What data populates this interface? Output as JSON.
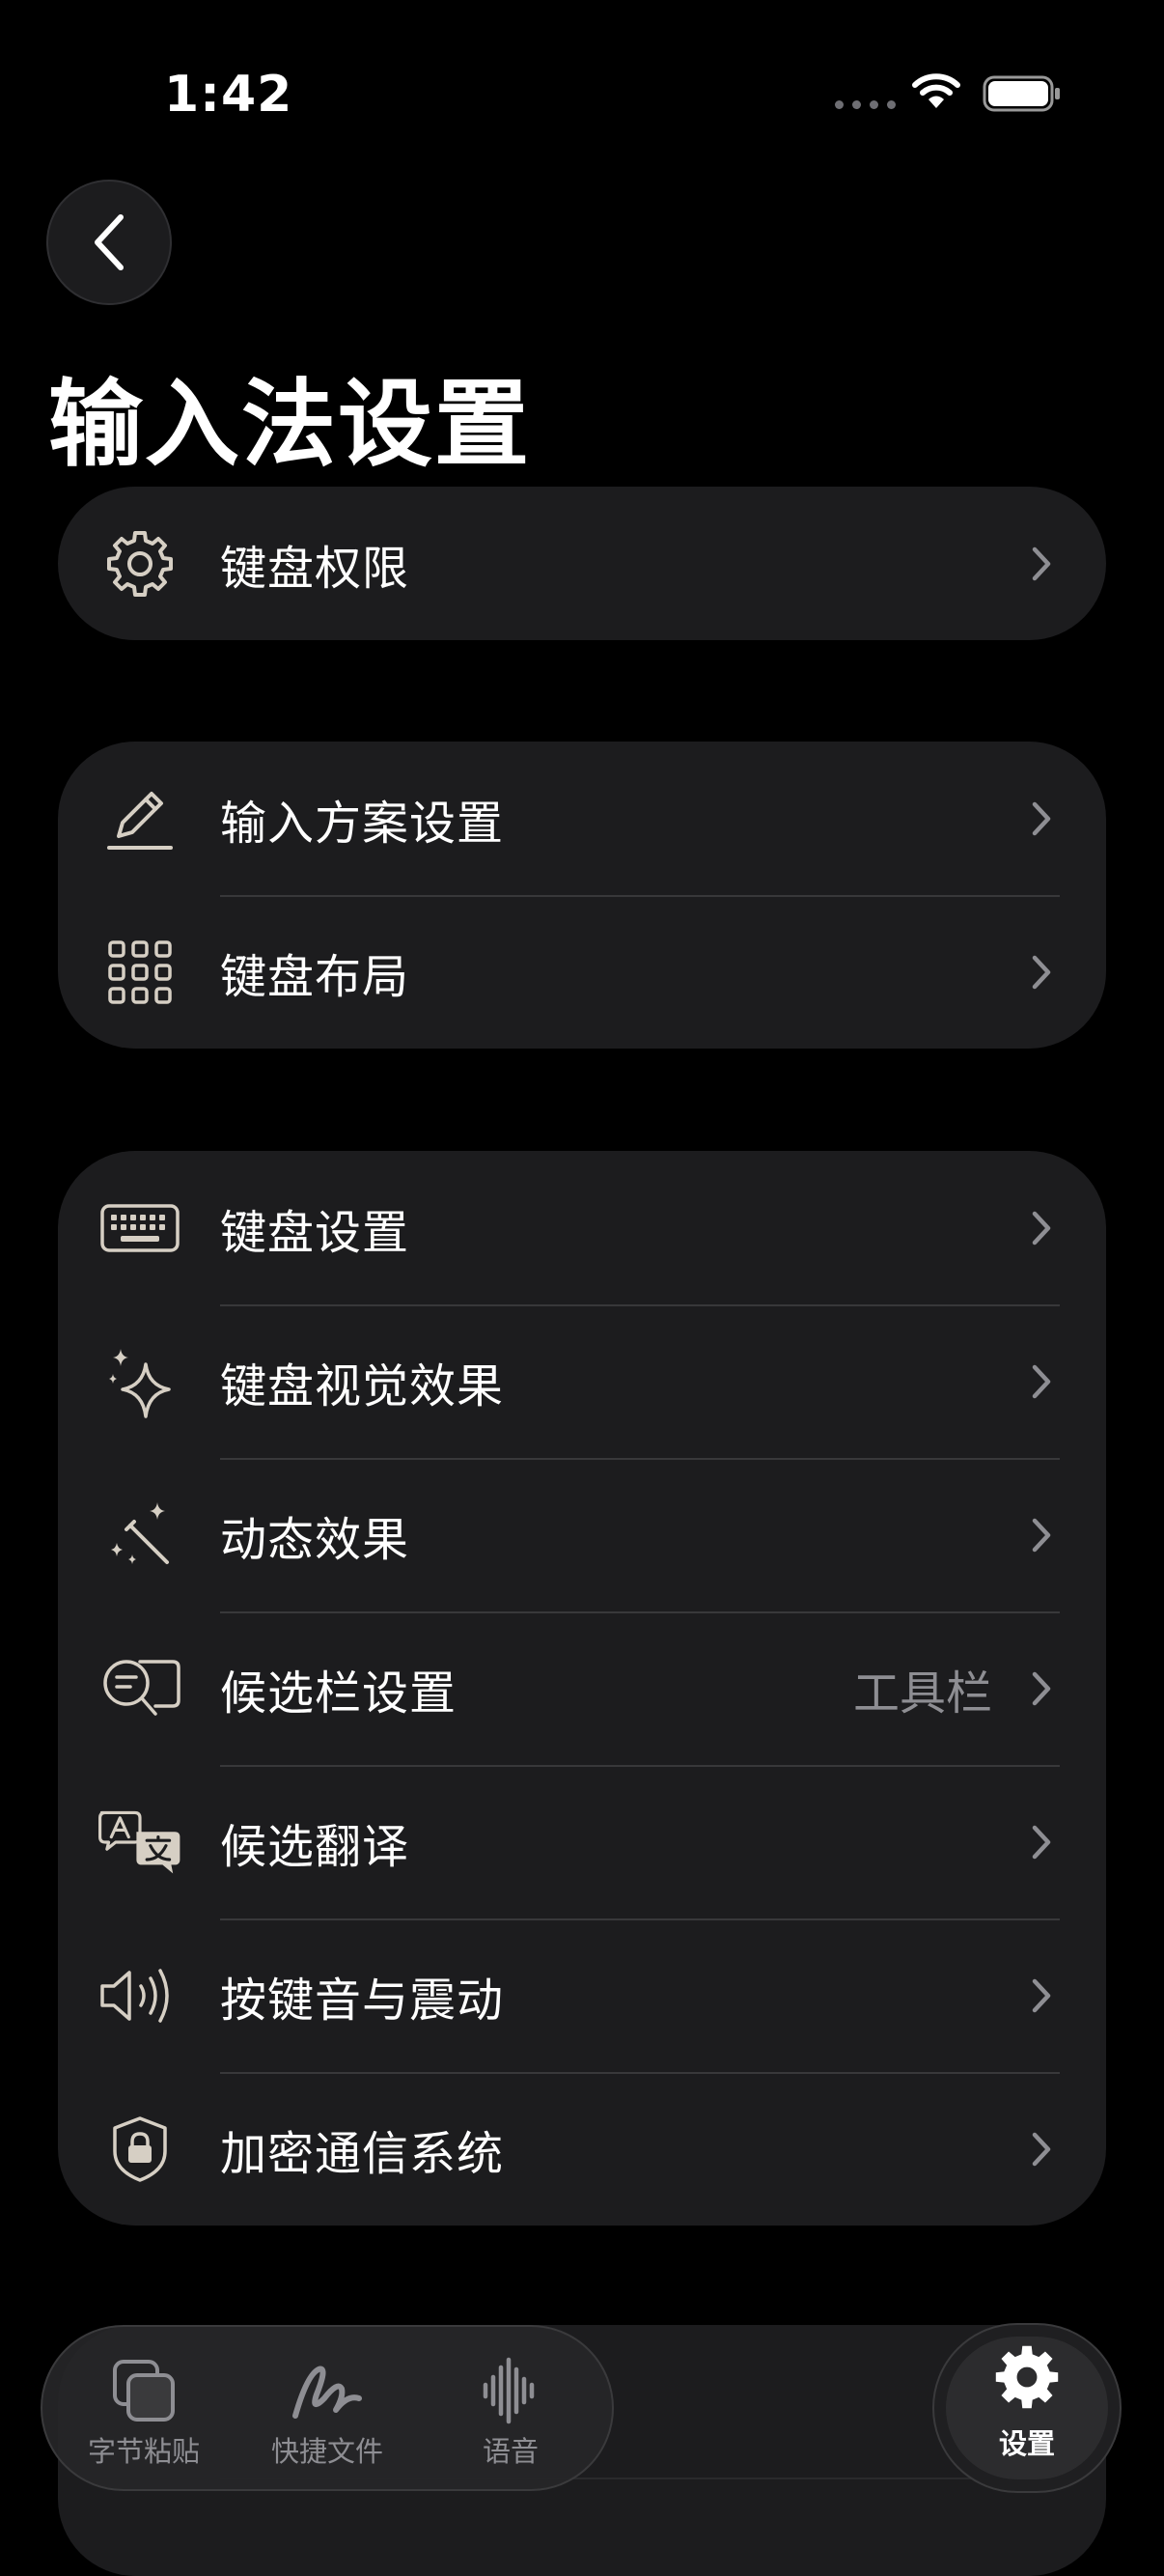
{
  "status_bar": {
    "time": "1:42"
  },
  "page": {
    "title": "输入法设置"
  },
  "groups": [
    {
      "items": [
        {
          "label": "键盘权限",
          "icon": "gear-icon"
        }
      ]
    },
    {
      "items": [
        {
          "label": "输入方案设置",
          "icon": "pencil-icon"
        },
        {
          "label": "键盘布局",
          "icon": "grid-icon"
        }
      ]
    },
    {
      "items": [
        {
          "label": "键盘设置",
          "icon": "keyboard-icon"
        },
        {
          "label": "键盘视觉效果",
          "icon": "sparkles-icon"
        },
        {
          "label": "动态效果",
          "icon": "magic-wand-icon"
        },
        {
          "label": "候选栏设置",
          "icon": "text-magnify-icon",
          "value": "工具栏"
        },
        {
          "label": "候选翻译",
          "icon": "translate-icon"
        },
        {
          "label": "按键音与震动",
          "icon": "speaker-wave-icon"
        },
        {
          "label": "加密通信系统",
          "icon": "lock-shield-icon"
        }
      ]
    }
  ],
  "tab_bar": {
    "tabs": [
      {
        "label": "字节粘贴",
        "icon": "clipboard-stack-icon"
      },
      {
        "label": "快捷文件",
        "icon": "scribble-icon"
      },
      {
        "label": "语音",
        "icon": "waveform-icon"
      }
    ],
    "settings": {
      "label": "设置",
      "icon": "gear-icon"
    }
  },
  "colors": {
    "background": "#000000",
    "card": "#1c1c1e",
    "icon": "#d6cfc4",
    "secondary_text": "#8e8e93",
    "separator": "#38383a"
  }
}
